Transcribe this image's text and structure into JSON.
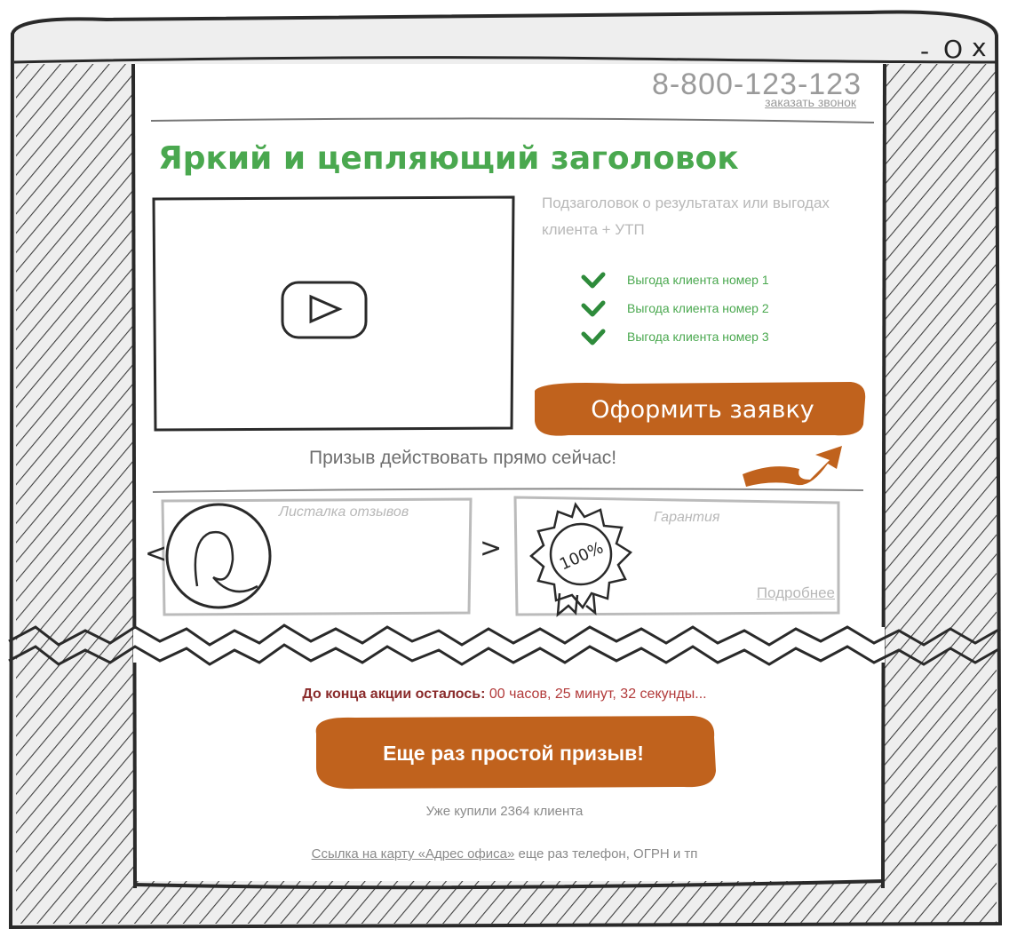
{
  "window": {
    "minimize_symbol": "-",
    "maximize_symbol": "O",
    "close_symbol": "x"
  },
  "header": {
    "phone": "8-800-123-123",
    "callback_link": "заказать звонок"
  },
  "hero": {
    "headline": "Яркий и цепляющий заголовок",
    "subtitle": "Подзаголовок о результатах или выгодах клиента + УТП",
    "benefits": [
      "Выгода клиента номер 1",
      "Выгода клиента номер 2",
      "Выгода клиента номер 3"
    ],
    "cta_label": "Оформить заявку",
    "cta_note": "Призыв действовать прямо сейчас!"
  },
  "panels": {
    "reviews_title": "Листалка отзывов",
    "prev_symbol": "<",
    "next_symbol": ">",
    "guarantee_title": "Гарантия",
    "seal_text": "100%",
    "more_link": "Подробнее"
  },
  "promo": {
    "countdown_label": "До конца акции осталось:",
    "countdown_value": "00 часов, 25 минут, 32 секунды...",
    "cta_label": "Еще раз простой призыв!",
    "bought_text": "Уже купили 2364 клиента"
  },
  "footer": {
    "map_link": "Ссылка на карту «Адрес офиса»",
    "rest": "еще раз телефон, ОГРН и тп"
  },
  "colors": {
    "accent_green": "#4aa84f",
    "cta_orange": "#c0621d",
    "countdown_red": "#8a2b2b",
    "sketch_line": "#2a2a2a",
    "muted_gray": "#b8b8b8"
  }
}
